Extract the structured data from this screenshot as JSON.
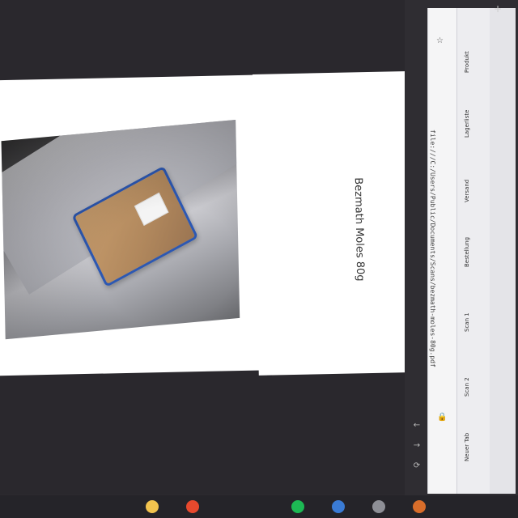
{
  "viewer": {
    "caption": "Bezmath Moles 80g"
  },
  "browser": {
    "address": "file:///C:/Users/Public/Documents/Scans/bezmath-moles-80g.pdf",
    "tabs": [
      "Produkt",
      "Lagerliste",
      "Versand",
      "Bestellung",
      "Scan 1",
      "Scan 2",
      "Neuer Tab"
    ]
  },
  "taskbar": {
    "icons": [
      "folder-icon",
      "chrome-icon",
      "spotify-icon",
      "mail-icon",
      "settings-icon",
      "app-icon"
    ]
  },
  "colors": {
    "package_blue": "#2d58b2",
    "package_brown": "#b1885d",
    "chrome_bg": "#2f2d32"
  }
}
